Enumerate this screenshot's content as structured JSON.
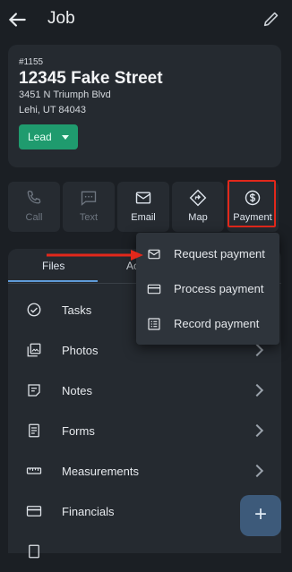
{
  "header": {
    "title": "Job"
  },
  "job": {
    "number": "#1155",
    "street": "12345 Fake Street",
    "address_line": "3451 N Triumph Blvd",
    "city_line": "Lehi, UT 84043",
    "status": "Lead"
  },
  "actions": [
    {
      "label": "Call",
      "enabled": false,
      "icon": "phone-icon"
    },
    {
      "label": "Text",
      "enabled": false,
      "icon": "message-icon"
    },
    {
      "label": "Email",
      "enabled": true,
      "icon": "mail-icon"
    },
    {
      "label": "Map",
      "enabled": true,
      "icon": "directions-icon"
    },
    {
      "label": "Payment",
      "enabled": true,
      "icon": "dollar-icon"
    }
  ],
  "tabs": {
    "files": "Files",
    "activity": "Ac"
  },
  "list": [
    {
      "label": "Tasks",
      "icon": "check-circle-icon"
    },
    {
      "label": "Photos",
      "icon": "photos-icon"
    },
    {
      "label": "Notes",
      "icon": "notes-icon"
    },
    {
      "label": "Forms",
      "icon": "forms-icon"
    },
    {
      "label": "Measurements",
      "icon": "ruler-icon"
    },
    {
      "label": "Financials",
      "icon": "card-icon"
    }
  ],
  "payment_menu": [
    {
      "label": "Request payment",
      "icon": "mail-icon"
    },
    {
      "label": "Process payment",
      "icon": "card-icon"
    },
    {
      "label": "Record payment",
      "icon": "record-icon"
    }
  ],
  "fab": {
    "label": "+"
  },
  "colors": {
    "accent": "#5f9bd8",
    "lead": "#1f9b6e",
    "highlight": "#e2281b"
  }
}
